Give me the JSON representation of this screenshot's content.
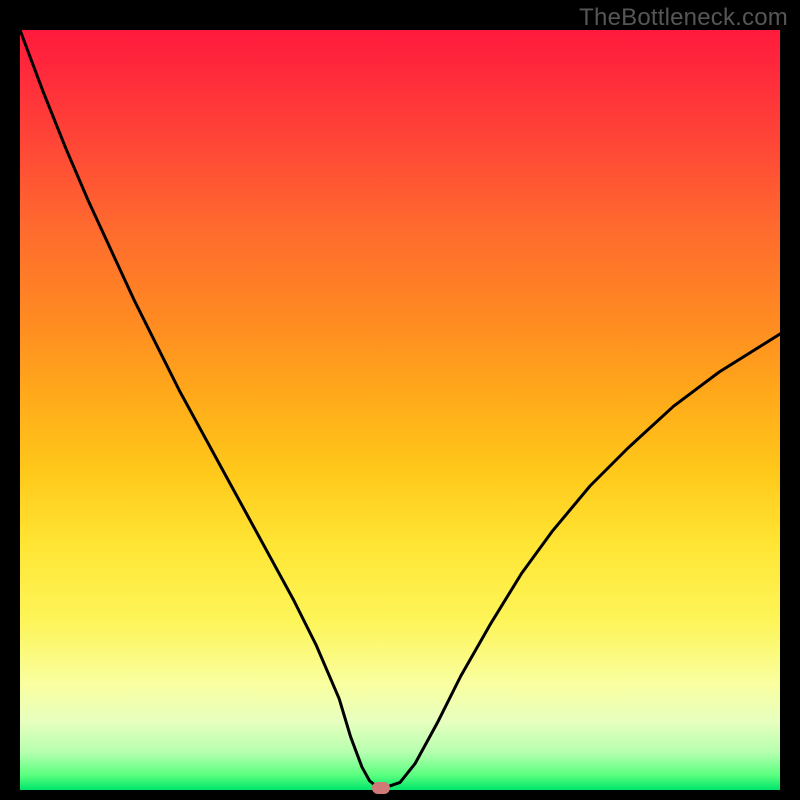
{
  "watermark": "TheBottleneck.com",
  "colors": {
    "curve": "#000000",
    "marker": "#cf7a78",
    "frame": "#000000"
  },
  "chart_data": {
    "type": "line",
    "title": "",
    "xlabel": "",
    "ylabel": "",
    "xlim": [
      0,
      100
    ],
    "ylim": [
      0,
      100
    ],
    "x": [
      0,
      3,
      6,
      9,
      12,
      15,
      18,
      21,
      24,
      27,
      30,
      33,
      36,
      39,
      42,
      43.5,
      45,
      46,
      47,
      48,
      50,
      52,
      55,
      58,
      62,
      66,
      70,
      75,
      80,
      86,
      92,
      100
    ],
    "y": [
      100,
      92,
      84.5,
      77.5,
      71,
      64.5,
      58.5,
      52.5,
      47,
      41.5,
      36,
      30.5,
      25,
      19,
      12,
      7,
      3,
      1.2,
      0.4,
      0.3,
      1,
      3.5,
      9,
      15,
      22,
      28.5,
      34,
      40,
      45,
      50.5,
      55,
      60
    ],
    "minimum": {
      "x": 47.5,
      "y": 0.3
    },
    "annotations": []
  }
}
